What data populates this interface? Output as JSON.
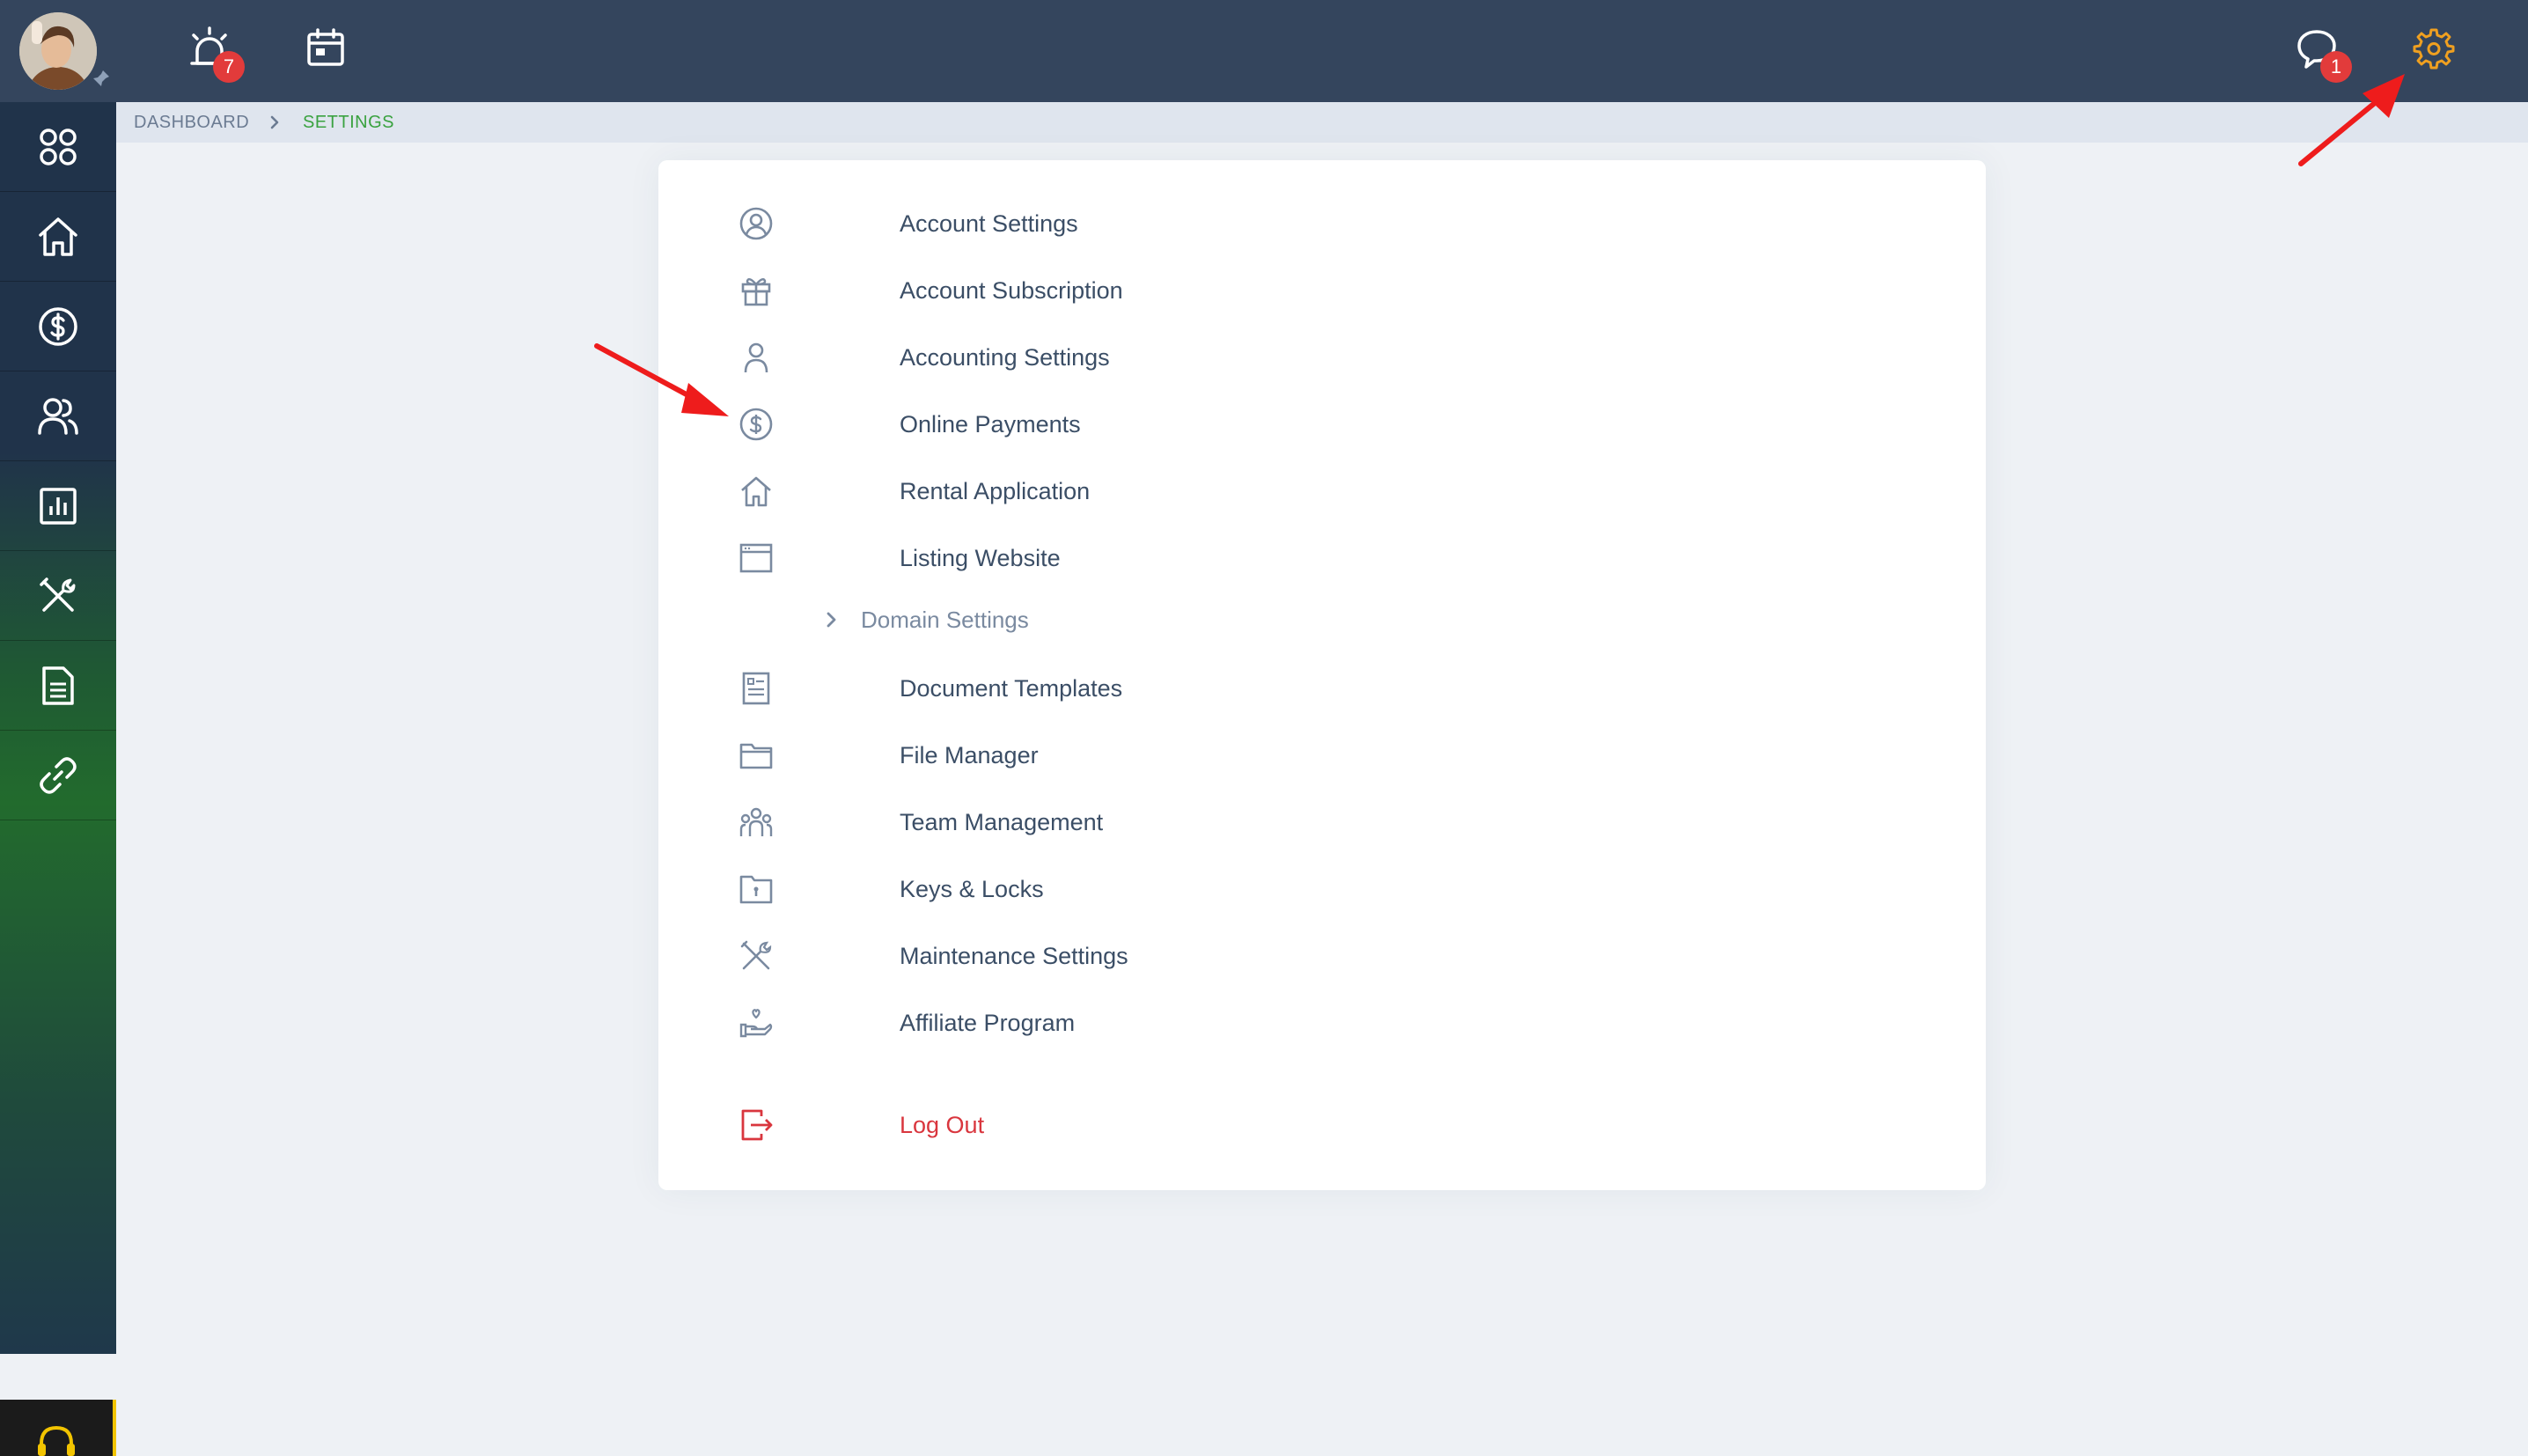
{
  "header": {
    "notification_count": "7",
    "message_count": "1"
  },
  "sidebar": {
    "items": [
      {
        "name": "apps-icon"
      },
      {
        "name": "home-icon"
      },
      {
        "name": "dollar-icon"
      },
      {
        "name": "people-icon"
      },
      {
        "name": "reports-icon"
      },
      {
        "name": "tools-icon"
      },
      {
        "name": "document-icon"
      },
      {
        "name": "link-icon"
      }
    ]
  },
  "breadcrumb": {
    "dashboard": "DASHBOARD",
    "settings": "SETTINGS"
  },
  "settings_menu": {
    "account_settings": "Account Settings",
    "account_subscription": "Account Subscription",
    "accounting_settings": "Accounting Settings",
    "online_payments": "Online Payments",
    "rental_application": "Rental Application",
    "listing_website": "Listing Website",
    "domain_settings": "Domain Settings",
    "document_templates": "Document Templates",
    "file_manager": "File Manager",
    "team_management": "Team Management",
    "keys_locks": "Keys & Locks",
    "maintenance_settings": "Maintenance Settings",
    "affiliate_program": "Affiliate Program",
    "log_out": "Log Out"
  },
  "colors": {
    "topbar": "#34455d",
    "accent_green": "#3aa240",
    "settings_gear_active": "#f0a020",
    "logout_red": "#d9363e",
    "annotation_arrow": "#ee1c1c"
  }
}
